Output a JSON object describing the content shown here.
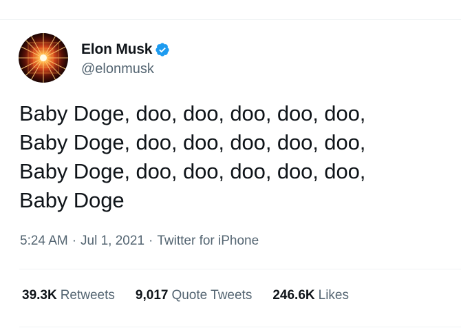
{
  "author": {
    "display_name": "Elon Musk",
    "handle": "@elonmusk",
    "verified": true,
    "verified_color": "#1d9bf0",
    "avatar_icon": "avatar-image"
  },
  "tweet": {
    "lines": [
      "Baby Doge, doo, doo, doo, doo, doo,",
      "Baby Doge, doo, doo, doo, doo, doo,",
      "Baby Doge, doo, doo, doo, doo, doo,",
      "Baby Doge"
    ]
  },
  "meta": {
    "time": "5:24 AM",
    "separator": "·",
    "date": "Jul 1, 2021",
    "source": "Twitter for iPhone"
  },
  "stats": {
    "retweets": {
      "count": "39.3K",
      "label": "Retweets"
    },
    "quote_tweets": {
      "count": "9,017",
      "label": "Quote Tweets"
    },
    "likes": {
      "count": "246.6K",
      "label": "Likes"
    }
  },
  "colors": {
    "text_primary": "#0f1419",
    "text_secondary": "#536471",
    "divider": "#eff3f4"
  }
}
